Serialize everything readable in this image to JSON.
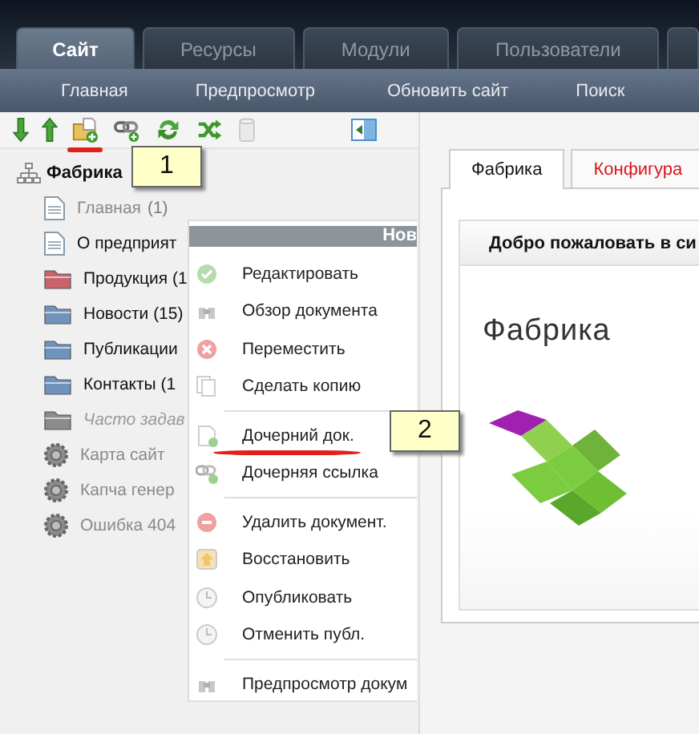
{
  "top_tabs": [
    {
      "label": "Сайт",
      "selected": true
    },
    {
      "label": "Ресурсы",
      "selected": false
    },
    {
      "label": "Модули",
      "selected": false
    },
    {
      "label": "Пользователи",
      "selected": false
    },
    {
      "selected": false
    }
  ],
  "subnav": [
    "Главная",
    "Предпросмотр",
    "Обновить сайт",
    "Поиск"
  ],
  "toolbar": {
    "buttons": [
      {
        "kind": "down",
        "disabled": false
      },
      {
        "kind": "up",
        "disabled": false
      },
      {
        "kind": "new-doc",
        "disabled": false,
        "marked": true
      },
      {
        "kind": "link",
        "disabled": false
      },
      {
        "kind": "refresh",
        "disabled": false
      },
      {
        "kind": "shuffle",
        "disabled": false
      },
      {
        "kind": "trash",
        "disabled": true
      },
      {
        "kind": "panel",
        "disabled": false
      }
    ]
  },
  "tree": {
    "label": "Фабрика",
    "children": [
      {
        "label": "Главная",
        "count": "(1)",
        "kind": "doc",
        "published": false,
        "hidden": false
      },
      {
        "label": "О предприят",
        "kind": "doc",
        "published": true,
        "hidden": false
      },
      {
        "label": "Продукция (1",
        "kind": "folder",
        "color": "#c9646a",
        "published": true,
        "hidden": false
      },
      {
        "label": "Новости (15)",
        "kind": "folder",
        "color": "#6f93bd",
        "published": true,
        "hidden": false
      },
      {
        "label": "Публикации",
        "kind": "folder",
        "color": "#6f93bd",
        "published": true,
        "hidden": false
      },
      {
        "label": "Контакты (1",
        "kind": "folder",
        "color": "#6f93bd",
        "published": true,
        "hidden": false
      },
      {
        "label": "Часто задав",
        "kind": "folder",
        "color": "#8c8c8c",
        "published": false,
        "hidden": true
      },
      {
        "label": "Карта сайт",
        "kind": "gear",
        "published": false,
        "hidden": false
      },
      {
        "label": "Капча генер",
        "kind": "gear",
        "published": false,
        "hidden": false
      },
      {
        "label": "Ошибка 404",
        "kind": "gear",
        "published": false,
        "hidden": false
      }
    ]
  },
  "context_menu": {
    "header": "Нов",
    "items": [
      {
        "kind": "edit",
        "label": "Редактировать"
      },
      {
        "kind": "view",
        "label": "Обзор документа"
      },
      {
        "kind": "move",
        "label": "Переместить"
      },
      {
        "kind": "copy",
        "label": "Сделать копию"
      },
      {
        "kind": "separator"
      },
      {
        "kind": "child-doc",
        "label": "Дочерний док.",
        "marked": true
      },
      {
        "kind": "child-link",
        "label": "Дочерняя ссылка"
      },
      {
        "kind": "separator"
      },
      {
        "kind": "delete",
        "label": "Удалить документ."
      },
      {
        "kind": "restore",
        "label": "Восстановить"
      },
      {
        "kind": "publish",
        "label": "Опубликовать"
      },
      {
        "kind": "unpublish",
        "label": "Отменить публ."
      },
      {
        "kind": "separator"
      },
      {
        "kind": "preview",
        "label": "Предпросмотр докум"
      }
    ]
  },
  "content": {
    "tabs": [
      {
        "label": "Фабрика",
        "selected": true,
        "alert": false
      },
      {
        "label": "Конфигура",
        "selected": false,
        "alert": true
      }
    ],
    "card": {
      "header": "Добро пожаловать в си",
      "title": "Фабрика"
    }
  },
  "callouts": [
    {
      "number": "1"
    },
    {
      "number": "2"
    }
  ]
}
